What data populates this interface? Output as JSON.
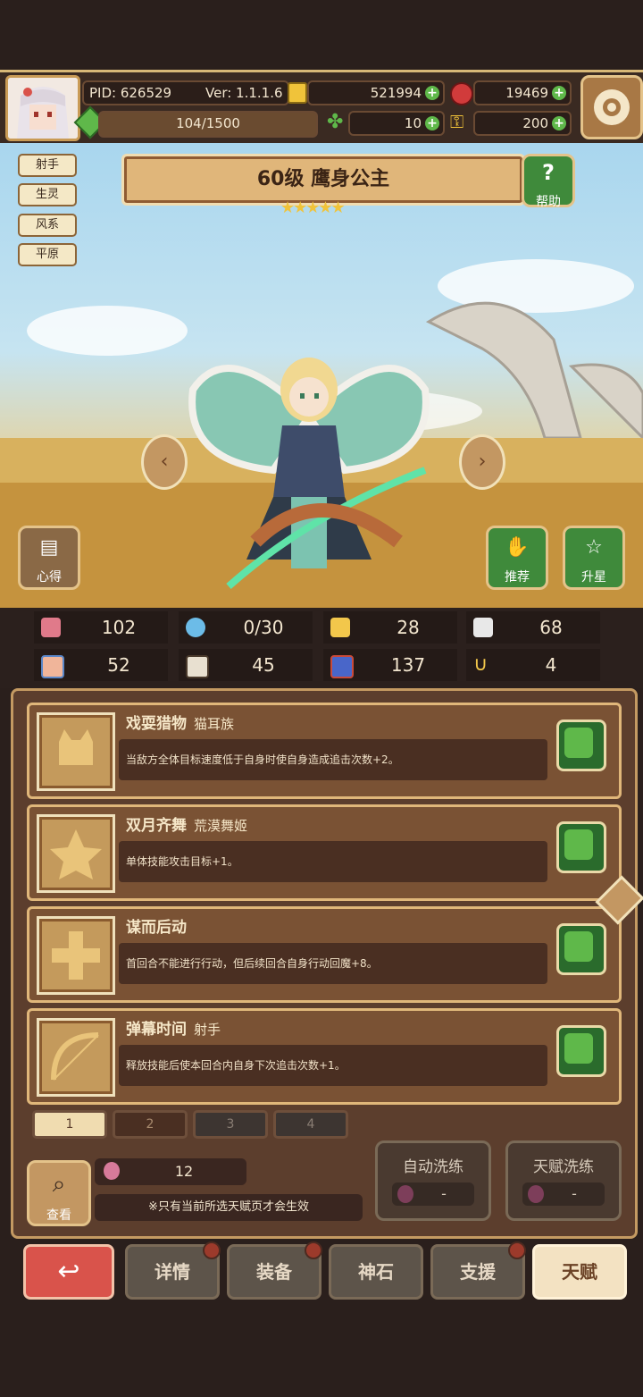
{
  "header": {
    "pid": "PID: 626529",
    "version": "Ver: 1.1.1.6",
    "gold": "521994",
    "gems": "19469",
    "stamina": "104/1500",
    "clover": "10",
    "keys": "200"
  },
  "hero": {
    "tags": [
      "射手",
      "生灵",
      "风系",
      "平原"
    ],
    "title": "60级 鹰身公主",
    "stars": 5,
    "help_label": "帮助",
    "insight_label": "心得",
    "recommend_label": "推荐",
    "star_up_label": "升星"
  },
  "stats": [
    {
      "icon": "heart-icon",
      "value": "102"
    },
    {
      "icon": "water-drop-icon",
      "value": "0/30"
    },
    {
      "icon": "shield-icon",
      "value": "28"
    },
    {
      "icon": "wing-icon",
      "value": "68"
    },
    {
      "icon": "fist-icon",
      "value": "52"
    },
    {
      "icon": "book-icon",
      "value": "45"
    },
    {
      "icon": "speed-icon",
      "value": "137"
    },
    {
      "icon": "horseshoe-icon",
      "value": "4"
    }
  ],
  "talents": [
    {
      "name": "戏耍猎物",
      "sub": "猫耳族",
      "desc": "当敌方全体目标速度低于自身时使自身造成追击次数+2。",
      "icon": "cat-icon"
    },
    {
      "name": "双月齐舞",
      "sub": "荒漠舞姬",
      "desc": "单体技能攻击目标+1。",
      "icon": "star-icon"
    },
    {
      "name": "谋而后动",
      "sub": "",
      "desc": "首回合不能进行行动，但后续回合自身行动回魔+8。",
      "icon": "cross-icon"
    },
    {
      "name": "弹幕时间",
      "sub": "射手",
      "desc": "释放技能后使本回合内自身下次追击次数+1。",
      "icon": "bow-icon"
    }
  ],
  "pages": [
    "1",
    "2",
    "3",
    "4"
  ],
  "footer_panel": {
    "view_label": "查看",
    "fruit_count": "12",
    "note": "※只有当前所选天赋页才会生效",
    "auto_wash_label": "自动洗练",
    "auto_wash_value": "-",
    "talent_wash_label": "天赋洗练",
    "talent_wash_value": "-"
  },
  "bottom_nav": [
    "详情",
    "装备",
    "神石",
    "支援",
    "天赋"
  ]
}
